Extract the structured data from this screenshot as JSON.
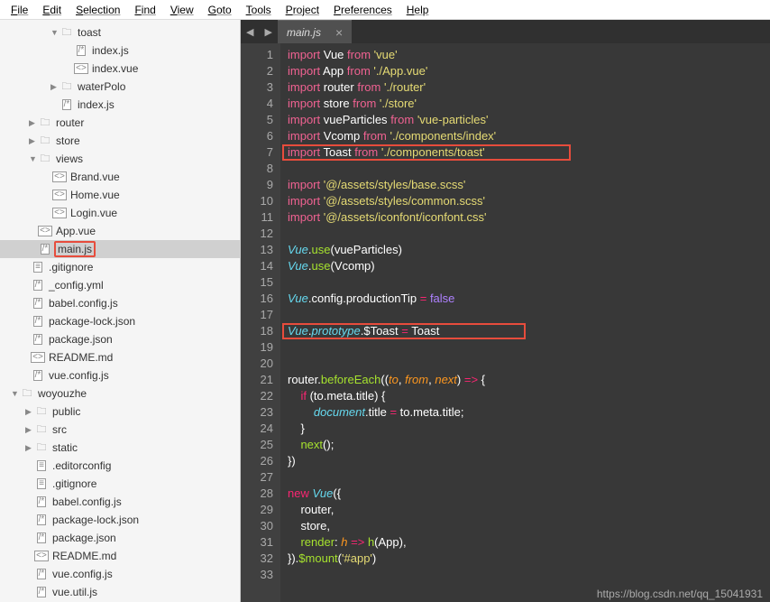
{
  "menu": [
    "File",
    "Edit",
    "Selection",
    "Find",
    "View",
    "Goto",
    "Tools",
    "Project",
    "Preferences",
    "Help"
  ],
  "tab": {
    "name": "main.js"
  },
  "tree": [
    {
      "indent": 56,
      "arrow": "▼",
      "type": "folder",
      "label": "toast"
    },
    {
      "indent": 72,
      "arrow": "",
      "type": "file",
      "icon": "/*",
      "label": "index.js"
    },
    {
      "indent": 72,
      "arrow": "",
      "type": "file",
      "icon": "<>",
      "label": "index.vue"
    },
    {
      "indent": 56,
      "arrow": "▶",
      "type": "folder",
      "label": "waterPolo"
    },
    {
      "indent": 56,
      "arrow": "",
      "type": "file",
      "icon": "/*",
      "label": "index.js"
    },
    {
      "indent": 32,
      "arrow": "▶",
      "type": "folder",
      "label": "router"
    },
    {
      "indent": 32,
      "arrow": "▶",
      "type": "folder",
      "label": "store"
    },
    {
      "indent": 32,
      "arrow": "▼",
      "type": "folder",
      "label": "views"
    },
    {
      "indent": 48,
      "arrow": "",
      "type": "file",
      "icon": "<>",
      "label": "Brand.vue"
    },
    {
      "indent": 48,
      "arrow": "",
      "type": "file",
      "icon": "<>",
      "label": "Home.vue"
    },
    {
      "indent": 48,
      "arrow": "",
      "type": "file",
      "icon": "<>",
      "label": "Login.vue"
    },
    {
      "indent": 32,
      "arrow": "",
      "type": "file",
      "icon": "<>",
      "label": "App.vue"
    },
    {
      "indent": 32,
      "arrow": "",
      "type": "file",
      "icon": "/*",
      "label": "main.js",
      "selected": true,
      "highlight": true
    },
    {
      "indent": 24,
      "arrow": "",
      "type": "file",
      "icon": "≡",
      "label": ".gitignore"
    },
    {
      "indent": 24,
      "arrow": "",
      "type": "file",
      "icon": "/*",
      "label": "_config.yml"
    },
    {
      "indent": 24,
      "arrow": "",
      "type": "file",
      "icon": "/*",
      "label": "babel.config.js"
    },
    {
      "indent": 24,
      "arrow": "",
      "type": "file",
      "icon": "/*",
      "label": "package-lock.json"
    },
    {
      "indent": 24,
      "arrow": "",
      "type": "file",
      "icon": "/*",
      "label": "package.json"
    },
    {
      "indent": 24,
      "arrow": "",
      "type": "file",
      "icon": "<>",
      "label": "README.md"
    },
    {
      "indent": 24,
      "arrow": "",
      "type": "file",
      "icon": "/*",
      "label": "vue.config.js"
    },
    {
      "indent": 12,
      "arrow": "▼",
      "type": "folder",
      "label": "woyouzhe"
    },
    {
      "indent": 28,
      "arrow": "▶",
      "type": "folder",
      "label": "public"
    },
    {
      "indent": 28,
      "arrow": "▶",
      "type": "folder",
      "label": "src"
    },
    {
      "indent": 28,
      "arrow": "▶",
      "type": "folder",
      "label": "static"
    },
    {
      "indent": 28,
      "arrow": "",
      "type": "file",
      "icon": "≡",
      "label": ".editorconfig"
    },
    {
      "indent": 28,
      "arrow": "",
      "type": "file",
      "icon": "≡",
      "label": ".gitignore"
    },
    {
      "indent": 28,
      "arrow": "",
      "type": "file",
      "icon": "/*",
      "label": "babel.config.js"
    },
    {
      "indent": 28,
      "arrow": "",
      "type": "file",
      "icon": "/*",
      "label": "package-lock.json"
    },
    {
      "indent": 28,
      "arrow": "",
      "type": "file",
      "icon": "/*",
      "label": "package.json"
    },
    {
      "indent": 28,
      "arrow": "",
      "type": "file",
      "icon": "<>",
      "label": "README.md"
    },
    {
      "indent": 28,
      "arrow": "",
      "type": "file",
      "icon": "/*",
      "label": "vue.config.js"
    },
    {
      "indent": 28,
      "arrow": "",
      "type": "file",
      "icon": "/*",
      "label": "vue.util.js"
    }
  ],
  "code_html": [
    "<span class='k-import'>import</span> <span class='k-plain'>Vue</span> <span class='k-import'>from</span> <span class='k-str'>'vue'</span>",
    "<span class='k-import'>import</span> <span class='k-plain'>App</span> <span class='k-import'>from</span> <span class='k-str'>'./App.vue'</span>",
    "<span class='k-import'>import</span> <span class='k-plain'>router</span> <span class='k-import'>from</span> <span class='k-str'>'./router'</span>",
    "<span class='k-import'>import</span> <span class='k-plain'>store</span> <span class='k-import'>from</span> <span class='k-str'>'./store'</span>",
    "<span class='k-import'>import</span> <span class='k-plain'>vueParticles</span> <span class='k-import'>from</span> <span class='k-str'>'vue-particles'</span>",
    "<span class='k-import'>import</span> <span class='k-plain'>Vcomp</span> <span class='k-import'>from</span> <span class='k-str'>'./components/index'</span>",
    "<span class='k-import'>import</span> <span class='k-plain'>Toast</span> <span class='k-import'>from</span> <span class='k-str'>'./components/toast'</span>",
    "",
    "<span class='k-import'>import</span> <span class='k-str'>'@/assets/styles/base.scss'</span>",
    "<span class='k-import'>import</span> <span class='k-str'>'@/assets/styles/common.scss'</span>",
    "<span class='k-import'>import</span> <span class='k-str'>'@/assets/iconfont/iconfont.css'</span>",
    "",
    "<span class='k-var'>Vue</span><span class='k-plain'>.</span><span class='k-fn'>use</span><span class='k-plain'>(vueParticles)</span>",
    "<span class='k-var'>Vue</span><span class='k-plain'>.</span><span class='k-fn'>use</span><span class='k-plain'>(Vcomp)</span>",
    "",
    "<span class='k-var'>Vue</span><span class='k-plain'>.config.productionTip </span><span class='k-op'>=</span> <span class='k-const'>false</span>",
    "",
    "<span class='k-var'>Vue</span><span class='k-plain'>.</span><span class='k-var'>prototype</span><span class='k-plain'>.$Toast </span><span class='k-op'>=</span><span class='k-plain'> Toast</span>",
    "",
    "",
    "<span class='k-plain'>router.</span><span class='k-fn'>beforeEach</span><span class='k-plain'>((</span><span class='k-param'>to</span><span class='k-plain'>, </span><span class='k-param'>from</span><span class='k-plain'>, </span><span class='k-param'>next</span><span class='k-plain'>) </span><span class='k-op'>=></span><span class='k-plain'> {</span>",
    "    <span class='k-op'>if</span><span class='k-plain'> (to.meta.title) {</span>",
    "        <span class='k-var'>document</span><span class='k-plain'>.title </span><span class='k-op'>=</span><span class='k-plain'> to.meta.title;</span>",
    "    <span class='k-plain'>}</span>",
    "    <span class='k-fn'>next</span><span class='k-plain'>();</span>",
    "<span class='k-plain'>})</span>",
    "",
    "<span class='k-op'>new</span> <span class='k-var'>Vue</span><span class='k-plain'>({</span>",
    "    <span class='k-plain'>router,</span>",
    "    <span class='k-plain'>store,</span>",
    "    <span class='k-fn'>render</span><span class='k-plain'>: </span><span class='k-param'>h</span> <span class='k-op'>=></span><span class='k-plain'> </span><span class='k-fn'>h</span><span class='k-plain'>(App),</span>",
    "<span class='k-plain'>}).</span><span class='k-fn'>$mount</span><span class='k-plain'>(</span><span class='k-str'>'#app'</span><span class='k-plain'>)</span>",
    ""
  ],
  "watermark": "https://blog.csdn.net/qq_15041931"
}
